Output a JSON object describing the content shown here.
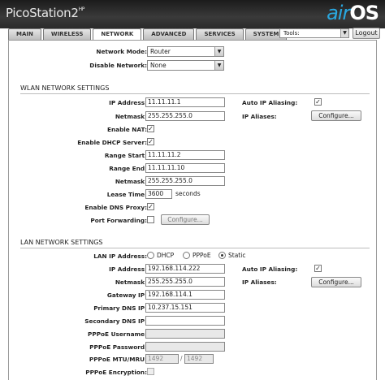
{
  "header": {
    "product": "PicoStation2",
    "product_sup": "HP",
    "logo_air": "air",
    "logo_os": "OS"
  },
  "tabs": [
    "MAIN",
    "WIRELESS",
    "NETWORK",
    "ADVANCED",
    "SERVICES",
    "SYSTEM"
  ],
  "tools": {
    "label": "Tools:",
    "logout": "Logout"
  },
  "top": {
    "network_mode_label": "Network Mode:",
    "network_mode_value": "Router",
    "disable_network_label": "Disable Network:",
    "disable_network_value": "None"
  },
  "wlan": {
    "title": "WLAN NETWORK SETTINGS",
    "ip_label": "IP Address:",
    "ip": "11.11.11.1",
    "netmask_label": "Netmask:",
    "netmask": "255.255.255.0",
    "auto_alias_label": "Auto IP Aliasing:",
    "aliases_label": "IP Aliases:",
    "configure": "Configure...",
    "enable_nat_label": "Enable NAT:",
    "enable_dhcp_label": "Enable DHCP Server:",
    "range_start_label": "Range Start:",
    "range_start": "11.11.11.2",
    "range_end_label": "Range End:",
    "range_end": "11.11.11.10",
    "dhcp_netmask_label": "Netmask:",
    "dhcp_netmask": "255.255.255.0",
    "lease_label": "Lease Time:",
    "lease": "3600",
    "lease_unit": "seconds",
    "dns_proxy_label": "Enable DNS Proxy:",
    "port_fwd_label": "Port Forwarding:",
    "port_fwd_btn": "Configure..."
  },
  "lan": {
    "title": "LAN NETWORK SETTINGS",
    "ip_mode_label": "LAN IP Address:",
    "opt_dhcp": "DHCP",
    "opt_pppoe": "PPPoE",
    "opt_static": "Static",
    "ip_label": "IP Address:",
    "ip": "192.168.114.222",
    "auto_alias_label": "Auto IP Aliasing:",
    "netmask_label": "Netmask:",
    "netmask": "255.255.255.0",
    "aliases_label": "IP Aliases:",
    "configure": "Configure...",
    "gateway_label": "Gateway IP:",
    "gateway": "192.168.114.1",
    "dns1_label": "Primary DNS IP:",
    "dns1": "10.237.15.151",
    "dns2_label": "Secondary DNS IP:",
    "dns2": "",
    "pppoe_user_label": "PPPoE Username:",
    "pppoe_user": "",
    "pppoe_pass_label": "PPPoE Password:",
    "pppoe_pass": "",
    "mtu_label": "PPPoE MTU/MRU:",
    "mtu": "1492",
    "mru": "1492",
    "encryption_label": "PPPoE Encryption:"
  }
}
